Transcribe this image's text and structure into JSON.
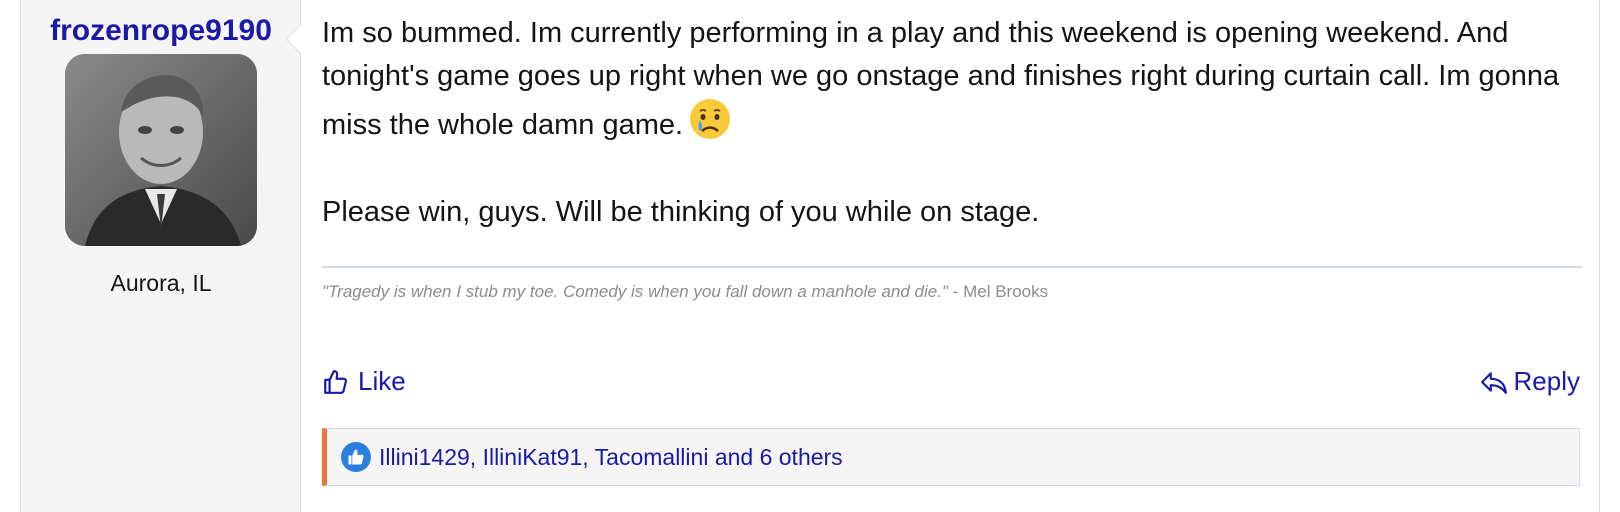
{
  "user": {
    "username": "frozenrope9190",
    "location": "Aurora, IL",
    "avatar_icon": "avatar-photo"
  },
  "message": {
    "paragraph1": "Im so bummed. Im currently performing in a play and this weekend is opening weekend. And tonight's game goes up right when we go onstage and finishes right during curtain call. Im gonna miss the whole damn game.",
    "emoji": "crying-face-emoji",
    "paragraph2": "Please win, guys. Will be thinking of you while on stage."
  },
  "signature": {
    "quote": "\"Tragedy is when I stub my toe. Comedy is when you fall down a manhole and die.\"",
    "attribution": " - Mel Brooks"
  },
  "actions": {
    "like_label": "Like",
    "reply_label": "Reply"
  },
  "reactions": {
    "text": "Illini1429, IlliniKat91, Tacomallini and 6 others",
    "icon": "thumbs-up-icon"
  },
  "colors": {
    "link": "#1a1aa6",
    "accent": "#e8753a",
    "reaction_blue": "#2a7fe0"
  }
}
